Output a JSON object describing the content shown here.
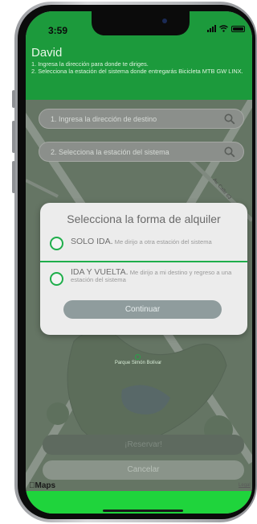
{
  "status_bar": {
    "time": "3:59"
  },
  "header": {
    "user_name": "David",
    "instructions": [
      "1. Ingresa la dirección para donde te diriges.",
      "2. Selecciona la estación del sistema donde entregarás Bicicleta MTB GW LINX."
    ],
    "background_color": "#1c9a3c"
  },
  "search": {
    "destination_placeholder": "1. Ingresa la dirección de destino",
    "station_placeholder": "2. Selecciona la estación del sistema"
  },
  "map": {
    "street_label": "Av. Calle 63",
    "park_label": "Parque Simón Bolívar",
    "provider": "Maps",
    "legal": "Legal"
  },
  "modal": {
    "title": "Selecciona la forma de alquiler",
    "options": [
      {
        "title": "SOLO IDA.",
        "description": "Me dirijo a otra estación del sistema"
      },
      {
        "title": "IDA Y VUELTA.",
        "description": "Me dirijo a mi destino y regreso a una estación del sistema"
      }
    ],
    "continue_label": "Continuar",
    "accent_color": "#1fae4b"
  },
  "actions": {
    "reserve_label": "¡Reservar!",
    "cancel_label": "Cancelar"
  },
  "footer": {
    "color": "#1fd43c"
  }
}
